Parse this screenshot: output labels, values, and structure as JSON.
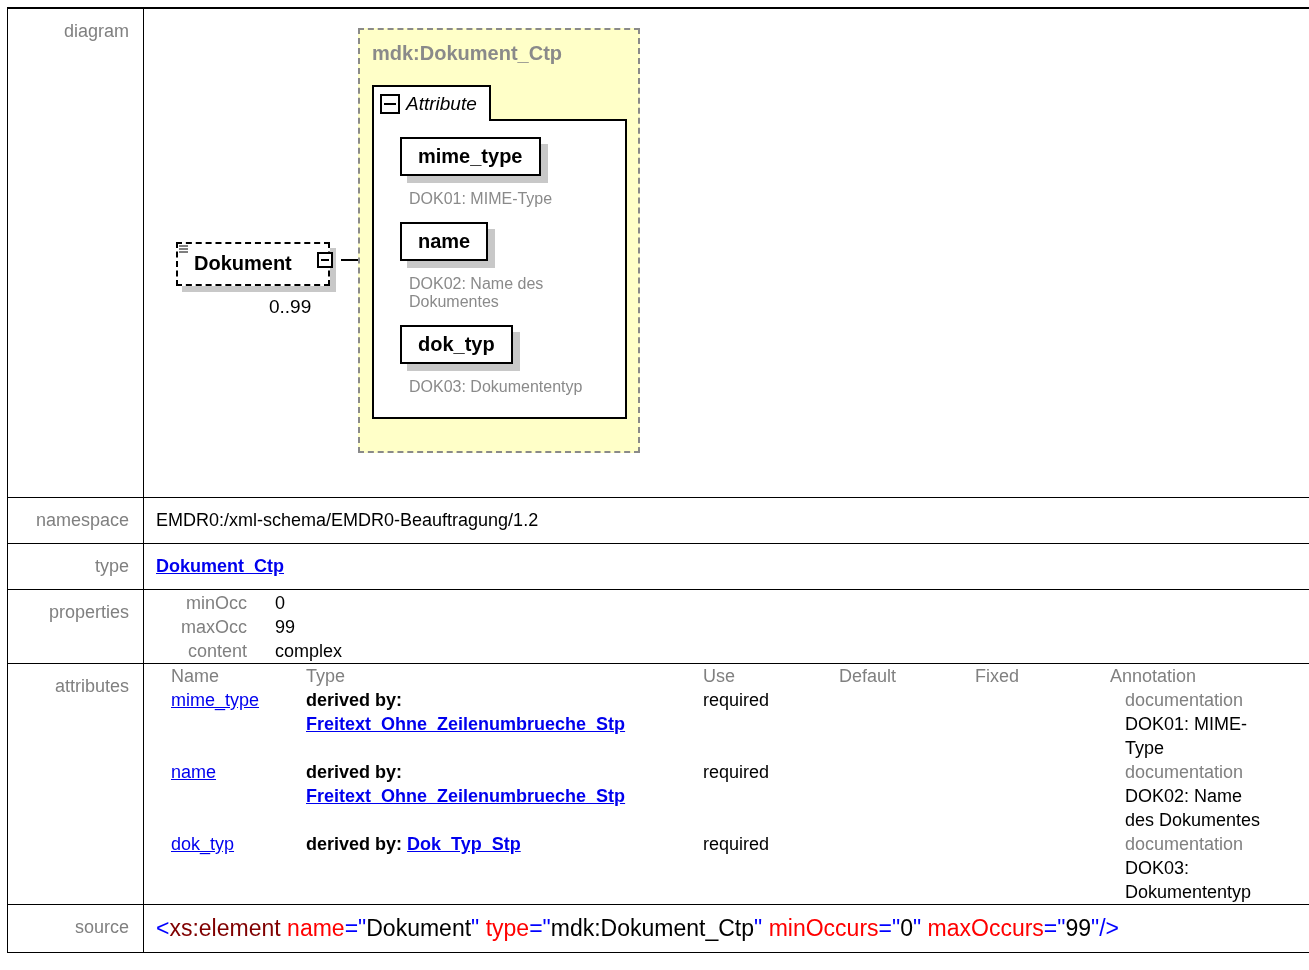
{
  "diagram": {
    "label": "diagram",
    "element": {
      "name": "Dokument",
      "occurrence": "0..99"
    },
    "type_box": {
      "title": "mdk:Dokument_Ctp",
      "group": {
        "title": "Attribute",
        "attributes": [
          {
            "name": "mime_type",
            "doc": "DOK01: MIME-Type"
          },
          {
            "name": "name",
            "doc": "DOK02: Name des Dokumentes"
          },
          {
            "name": "dok_typ",
            "doc": "DOK03: Dokumententyp"
          }
        ]
      }
    }
  },
  "namespace": {
    "label": "namespace",
    "value": "EMDR0:/xml-schema/EMDR0-Beauftragung/1.2"
  },
  "type": {
    "label": "type",
    "link": "Dokument_Ctp"
  },
  "properties": {
    "label": "properties",
    "items": [
      {
        "name": "minOcc",
        "value": "0"
      },
      {
        "name": "maxOcc",
        "value": "99"
      },
      {
        "name": "content",
        "value": "complex"
      }
    ]
  },
  "attributes": {
    "label": "attributes",
    "columns": [
      "Name",
      "Type",
      "Use",
      "Default",
      "Fixed",
      "Annotation"
    ],
    "rows": [
      {
        "name": "mime_type",
        "derived": "derived by:",
        "type_link": "Freitext_Ohne_Zeilenumbrueche_Stp",
        "use": "required",
        "annotation_label": "documentation",
        "annotation": "DOK01: MIME-Type"
      },
      {
        "name": "name",
        "derived": "derived by:",
        "type_link": "Freitext_Ohne_Zeilenumbrueche_Stp",
        "use": "required",
        "annotation_label": "documentation",
        "annotation": "DOK02: Name des Dokumentes"
      },
      {
        "name": "dok_typ",
        "derived": "derived by:",
        "type_link": "Dok_Typ_Stp",
        "use": "required",
        "annotation_label": "documentation",
        "annotation": "DOK03: Dokumententyp"
      }
    ]
  },
  "source": {
    "label": "source",
    "tokens": [
      {
        "kind": "punct",
        "text": "<"
      },
      {
        "kind": "tag",
        "text": "xs:element"
      },
      {
        "kind": "attr",
        "text": "name"
      },
      {
        "kind": "punct",
        "text": "=\""
      },
      {
        "kind": "value",
        "text": "Dokument"
      },
      {
        "kind": "punct",
        "text": "\""
      },
      {
        "kind": "attr",
        "text": "type"
      },
      {
        "kind": "punct",
        "text": "=\""
      },
      {
        "kind": "value",
        "text": "mdk:Dokument_Ctp"
      },
      {
        "kind": "punct",
        "text": "\""
      },
      {
        "kind": "attr",
        "text": "minOccurs"
      },
      {
        "kind": "punct",
        "text": "=\""
      },
      {
        "kind": "value",
        "text": "0"
      },
      {
        "kind": "punct",
        "text": "\""
      },
      {
        "kind": "attr",
        "text": "maxOccurs"
      },
      {
        "kind": "punct",
        "text": "=\""
      },
      {
        "kind": "value",
        "text": "99"
      },
      {
        "kind": "punct",
        "text": "\"/>"
      }
    ]
  }
}
